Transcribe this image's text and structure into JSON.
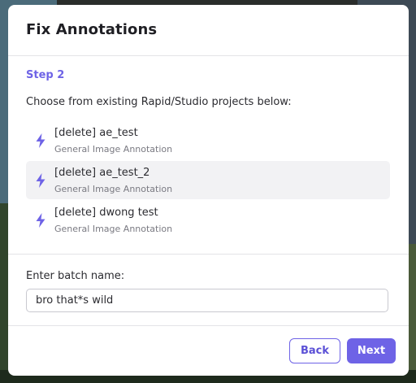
{
  "dialog": {
    "title": "Fix Annotations",
    "step": "Step 2",
    "instruction": "Choose from existing Rapid/Studio projects below:",
    "projects": [
      {
        "name": "[delete] ae_test",
        "type": "General Image Annotation",
        "icon": "lightning-bolt-icon"
      },
      {
        "name": "[delete] ae_test_2",
        "type": "General Image Annotation",
        "icon": "lightning-bolt-icon"
      },
      {
        "name": "[delete] dwong test",
        "type": "General Image Annotation",
        "icon": "lightning-bolt-icon"
      }
    ],
    "batch": {
      "label": "Enter batch name:",
      "value": "bro that*s wild"
    },
    "buttons": {
      "back": "Back",
      "next": "Next"
    }
  },
  "colors": {
    "accent": "#6e63e6",
    "hover_row": "#f2f2f4",
    "text": "#2b2b30",
    "muted_text": "#7a7a82"
  }
}
